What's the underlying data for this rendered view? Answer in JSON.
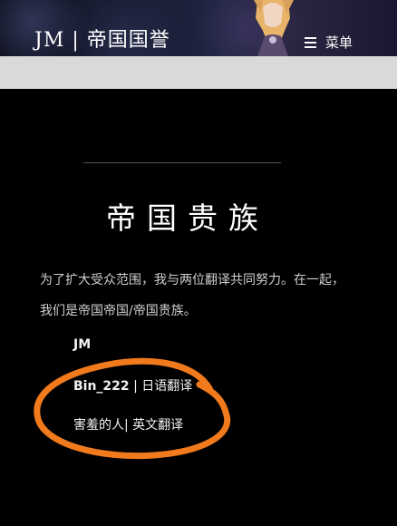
{
  "header": {
    "brand": "JM | 帝国国誉",
    "menu_label": "菜单",
    "menu_icon": "hamburger-menu-icon"
  },
  "main": {
    "title": "帝国贵族",
    "intro": "为了扩大受众范围，我与两位翻译共同努力。在一起，我们是帝国帝国/帝国贵族。",
    "credits": [
      {
        "name": "JM",
        "role": ""
      },
      {
        "name": "Bin_222",
        "role": " | 日语翻译"
      },
      {
        "name": "害羞的人",
        "role": "| 英文翻译"
      }
    ]
  },
  "colors": {
    "background": "#000000",
    "grey_bar": "#d9d9d9",
    "highlight_circle": "#f07a1c"
  }
}
